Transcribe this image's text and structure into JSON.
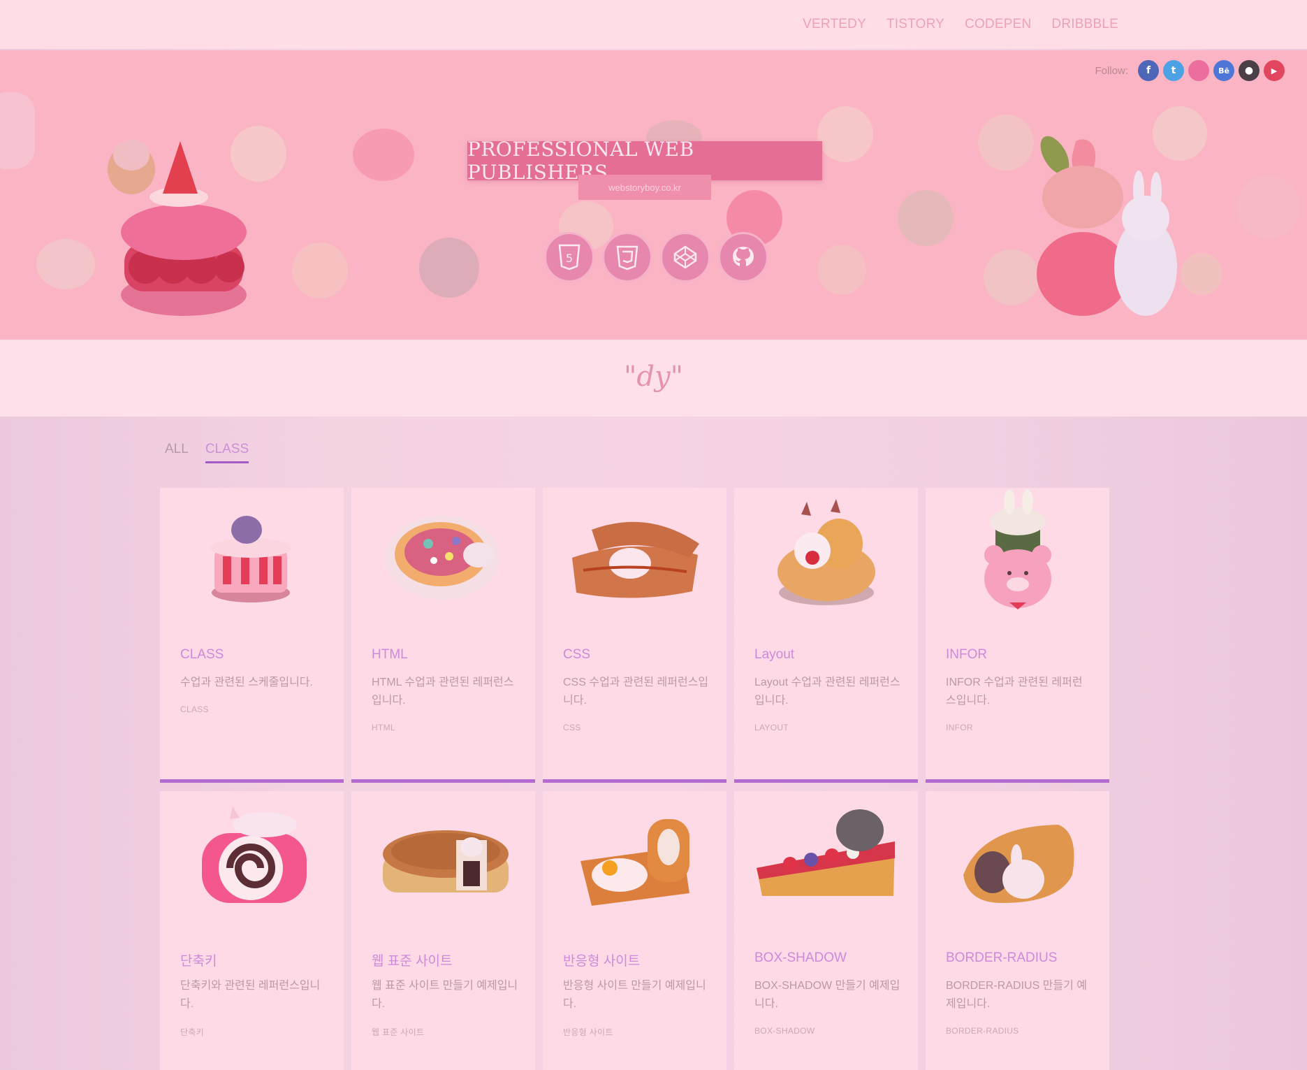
{
  "topnav": {
    "items": [
      {
        "label": "VERTEDY"
      },
      {
        "label": "TISTORY"
      },
      {
        "label": "CODEPEN"
      },
      {
        "label": "DRIBBBLE"
      }
    ]
  },
  "hero": {
    "follow_label": "Follow:",
    "socials": [
      {
        "icon": "facebook-icon",
        "glyph": "f",
        "color": "#4e66b7"
      },
      {
        "icon": "twitter-icon",
        "glyph": "t",
        "color": "#4da2e6"
      },
      {
        "icon": "dribbble-icon",
        "glyph": "",
        "color": "#ec6e9e"
      },
      {
        "icon": "behance-icon",
        "glyph": "Bē",
        "color": "#4d76d6"
      },
      {
        "icon": "github-icon",
        "glyph": "●",
        "color": "#4a3f47"
      },
      {
        "icon": "youtube-icon",
        "glyph": "▶",
        "color": "#e2455e"
      }
    ],
    "title": "PROFESSIONAL WEB PUBLISHERS",
    "subtitle": "webstoryboy.co.kr",
    "tech_icons": [
      "html5-icon",
      "css3-icon",
      "codepen-icon",
      "github-icon"
    ]
  },
  "logo": {
    "text": "\"dy\""
  },
  "tabs": [
    {
      "label": "ALL",
      "active": false
    },
    {
      "label": "CLASS",
      "active": true
    }
  ],
  "cards": [
    {
      "title": "CLASS",
      "desc": "수업과 관련된 스케줄입니다.",
      "tag": "CLASS",
      "image": "pink-carousel-dessert"
    },
    {
      "title": "HTML",
      "desc": "HTML 수업과 관련된 레퍼런스입니다.",
      "tag": "HTML",
      "image": "fruit-pizza-dessert"
    },
    {
      "title": "CSS",
      "desc": "CSS 수업과 관련된 레퍼런스입니다.",
      "tag": "CSS",
      "image": "toast-sandwich-dessert"
    },
    {
      "title": "Layout",
      "desc": "Layout 수업과 관련된 레퍼런스입니다.",
      "tag": "LAYOUT",
      "image": "fox-tart-dessert"
    },
    {
      "title": "INFOR",
      "desc": "INFOR 수업과 관련된 레퍼런스입니다.",
      "tag": "INFOR",
      "image": "bear-cup-dessert"
    },
    {
      "title": "단축키",
      "desc": "단축키와 관련된 레퍼런스입니다.",
      "tag": "단축키",
      "image": "pink-roll-cake"
    },
    {
      "title": "웹 표준 사이트",
      "desc": "웹 표준 사이트 만들기 예제입니다.",
      "tag": "웹 표준 사이트",
      "image": "pie-dessert"
    },
    {
      "title": "반응형 사이트",
      "desc": "반응형 사이트 만들기 예제입니다.",
      "tag": "반응형 사이트",
      "image": "bread-loaf-dessert"
    },
    {
      "title": "BOX-SHADOW",
      "desc": "BOX-SHADOW 만들기 예제입니다.",
      "tag": "BOX-SHADOW",
      "image": "berry-cake-slice"
    },
    {
      "title": "BORDER-RADIUS",
      "desc": "BORDER-RADIUS 만들기 예제입니다.",
      "tag": "BORDER-RADIUS",
      "image": "croissant-dessert"
    }
  ]
}
